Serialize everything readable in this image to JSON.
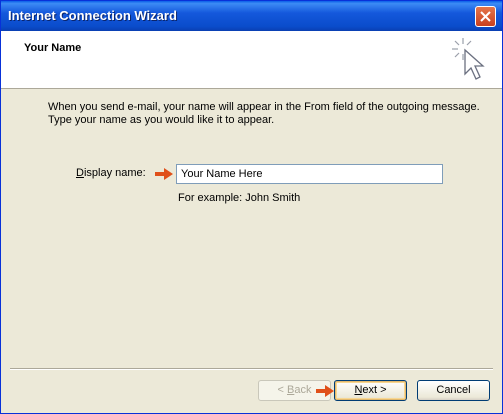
{
  "window": {
    "title": "Internet Connection Wizard"
  },
  "header": {
    "title": "Your Name"
  },
  "intro": {
    "line1": "When you send e-mail, your name will appear in the From field of the outgoing message.",
    "line2": "Type your name as you would like it to appear."
  },
  "form": {
    "display_name_label_mnemonic": "D",
    "display_name_label_rest": "isplay name:",
    "display_name_value": "Your Name Here",
    "example_text": "For example: John Smith"
  },
  "buttons": {
    "back_prefix": "< ",
    "back_mnemonic": "B",
    "back_rest": "ack",
    "next_mnemonic": "N",
    "next_rest": "ext >",
    "cancel": "Cancel"
  },
  "colors": {
    "accent_arrow": "#e0501a",
    "titlebar": "#0a4ccb",
    "dialog_bg": "#ece9d8"
  },
  "icons": [
    "close-icon",
    "wizard-sparkle-icon",
    "pointer-arrow-icon"
  ]
}
